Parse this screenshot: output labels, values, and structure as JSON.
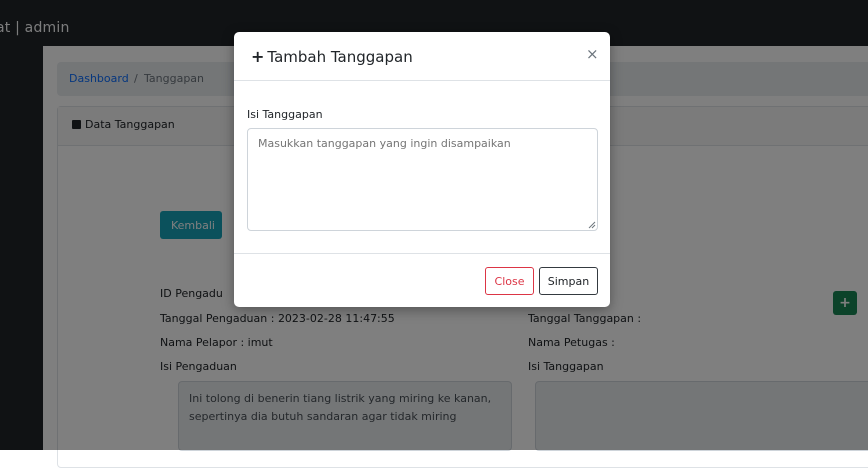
{
  "navbar": {
    "brand": "at | admin"
  },
  "breadcrumb": {
    "link": "Dashboard",
    "separator": "/",
    "current": "Tanggapan"
  },
  "card": {
    "header_title": "Data Tanggapan",
    "header_icon": "table-icon"
  },
  "buttons": {
    "kembali": "Kembali",
    "add": "+"
  },
  "complaint": {
    "id_label": "ID Pengadu",
    "date_line": "Tanggal Pengaduan : 2023-02-28 11:47:55",
    "reporter_line": "Nama Pelapor : imut",
    "content_label": "Isi Pengaduan",
    "content_text": "Ini tolong di benerin tiang listrik yang miring ke kanan, sepertinya dia butuh sandaran agar tidak miring"
  },
  "response": {
    "date_line": "Tanggal Tanggapan :",
    "officer_line": "Nama Petugas :",
    "content_label": "Isi Tanggapan",
    "content_text": ""
  },
  "modal": {
    "title": "Tambah Tanggapan",
    "title_icon": "plus-icon",
    "close_icon": "×",
    "field_label": "Isi Tanggapan",
    "textarea_placeholder": "Masukkan tanggapan yang ingin disampaikan",
    "close_button": "Close",
    "save_button": "Simpan"
  },
  "colors": {
    "navbar": "#212529",
    "kembali": "#17a2b8",
    "add": "#198754",
    "close_button": "#dc3545",
    "link": "#0d6efd"
  }
}
